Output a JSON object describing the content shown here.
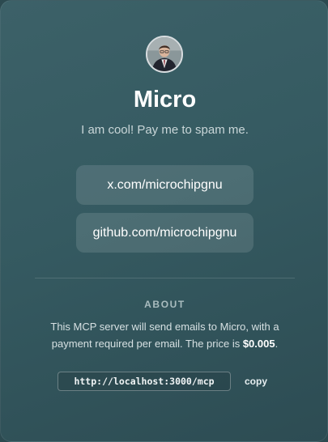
{
  "profile": {
    "avatar_icon": "profile-photo-avatar",
    "name": "Micro",
    "tagline": "I am cool! Pay me to spam me."
  },
  "links": [
    {
      "label": "x.com/microchipgnu"
    },
    {
      "label": "github.com/microchipgnu"
    }
  ],
  "about": {
    "heading": "ABOUT",
    "text_before_price": "This MCP server will send emails to Micro, with a payment required per email. The price is ",
    "price": "$0.005",
    "text_after_price": "."
  },
  "endpoint": {
    "url": "http://localhost:3000/mcp",
    "copy_label": "copy"
  },
  "colors": {
    "card_background": "#355a61",
    "button_background": "#4a6c72",
    "text_primary": "#ffffff",
    "text_secondary": "#c9d6d8"
  }
}
